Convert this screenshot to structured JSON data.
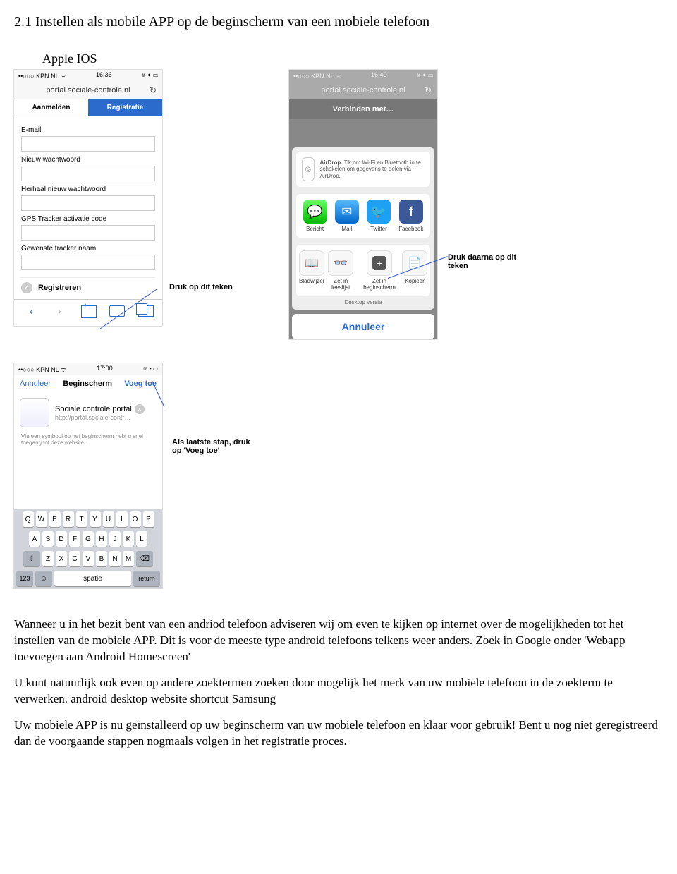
{
  "heading": "2.1 Instellen als mobile APP op de beginscherm van een mobiele telefoon",
  "apple_label": "Apple IOS",
  "phone1": {
    "carrier": "••○○○ KPN NL ᯤ",
    "time": "16:36",
    "batt": "ෂ ◐ ▭",
    "url": "portal.sociale-controle.nl",
    "tab_login": "Aanmelden",
    "tab_register": "Registratie",
    "lbl_email": "E-mail",
    "lbl_pw": "Nieuw wachtwoord",
    "lbl_pw2": "Herhaal nieuw wachtwoord",
    "lbl_gps": "GPS Tracker activatie code",
    "lbl_name": "Gewenste tracker naam",
    "btn_register": "Registreren"
  },
  "annotation1": "Druk op dit teken",
  "phone2": {
    "carrier": "••○○○ KPN NL ᯤ",
    "time": "16:40",
    "batt": "ෂ ◐ ▭",
    "url": "portal.sociale-controle.nl",
    "connect": "Verbinden met…",
    "airdrop_title": "AirDrop.",
    "airdrop_text": "Tik om Wi-Fi en Bluetooth in te schakelen om gegevens te delen via AirDrop.",
    "apps": {
      "msg": "Bericht",
      "mail": "Mail",
      "tw": "Twitter",
      "fb": "Facebook"
    },
    "actions": {
      "bookmark": "Bladwijzer",
      "readlist": "Zet in leeslijst",
      "homescreen": "Zet in beginscherm",
      "copy": "Kopieer"
    },
    "desktop": "Desktop versie",
    "cancel": "Annuleer"
  },
  "annotation2": "Druk daarna op dit teken",
  "phone3": {
    "carrier": "••○○○ KPN NL ᯤ",
    "time": "17:00",
    "batt": "ෂ ▪ ▭",
    "nav_cancel": "Annuleer",
    "nav_title": "Beginscherm",
    "nav_add": "Voeg toe",
    "site_name": "Sociale controle portal",
    "site_url": "http://portal.sociale-contr…",
    "hint": "Via een symbool op het beginscherm hebt u snel toegang tot deze website.",
    "kb": {
      "row1": [
        "Q",
        "W",
        "E",
        "R",
        "T",
        "Y",
        "U",
        "I",
        "O",
        "P"
      ],
      "row2": [
        "A",
        "S",
        "D",
        "F",
        "G",
        "H",
        "J",
        "K",
        "L"
      ],
      "row3": [
        "Z",
        "X",
        "C",
        "V",
        "B",
        "N",
        "M"
      ],
      "shift": "⇧",
      "back": "⌫",
      "num": "123",
      "emoji": "☺",
      "space": "spatie",
      "return": "return"
    }
  },
  "annotation3": "Als laatste stap, druk op 'Voeg toe'",
  "para1": "Wanneer u in het bezit bent van een andriod telefoon adviseren wij om even te kijken op internet over de mogelijkheden tot het instellen van de mobiele APP. Dit is voor de meeste type android telefoons telkens weer anders. Zoek in Google onder 'Webapp toevoegen aan Android Homescreen'",
  "para2": "U kunt natuurlijk ook even op andere zoektermen zoeken door mogelijk het merk van uw mobiele telefoon in de zoekterm te verwerken. android desktop website shortcut Samsung",
  "para3": "Uw mobiele APP is nu geïnstalleerd op uw beginscherm van uw mobiele telefoon en klaar voor gebruik! Bent u nog niet geregistreerd dan de voorgaande stappen nogmaals volgen in het registratie proces."
}
